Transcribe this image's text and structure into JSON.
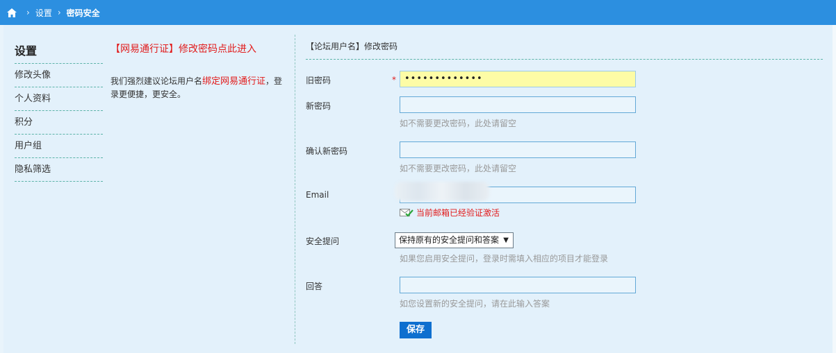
{
  "breadcrumb": {
    "home_icon": "home-icon",
    "sep1": "›",
    "settings": "设置",
    "sep2": "›",
    "current": "密码安全"
  },
  "sidebar": {
    "title": "设置",
    "items": [
      {
        "label": "修改头像"
      },
      {
        "label": "个人资料"
      },
      {
        "label": "积分"
      },
      {
        "label": "用户组"
      },
      {
        "label": "隐私筛选"
      }
    ]
  },
  "promo": {
    "link": "【网易通行证】修改密码点此进入",
    "text_prefix": "我们强烈建议论坛用户名",
    "text_link": "绑定网易通行证",
    "text_suffix": "，登录更便捷，更安全。"
  },
  "form": {
    "header": "【论坛用户名】修改密码",
    "old_password": {
      "label": "旧密码",
      "required_mark": "*",
      "value": "•••••••••••••"
    },
    "new_password": {
      "label": "新密码",
      "value": "",
      "hint": "如不需要更改密码，此处请留空"
    },
    "confirm_password": {
      "label": "确认新密码",
      "value": "",
      "hint": "如不需要更改密码，此处请留空"
    },
    "email": {
      "label": "Email",
      "value": "",
      "status": "当前邮箱已经验证激活",
      "status_icon": "mail-verified-icon"
    },
    "security_question": {
      "label": "安全提问",
      "selected": "保持原有的安全提问和答案",
      "arrow": "▼",
      "hint": "如果您启用安全提问，登录时需填入相应的项目才能登录"
    },
    "answer": {
      "label": "回答",
      "value": "",
      "hint": "如您设置新的安全提问，请在此输入答案"
    },
    "save_label": "保存"
  },
  "colors": {
    "topbar": "#2c8fe0",
    "accent_red": "#e21b1b",
    "button": "#0e6fcf",
    "input_highlight": "#fdfca6"
  }
}
